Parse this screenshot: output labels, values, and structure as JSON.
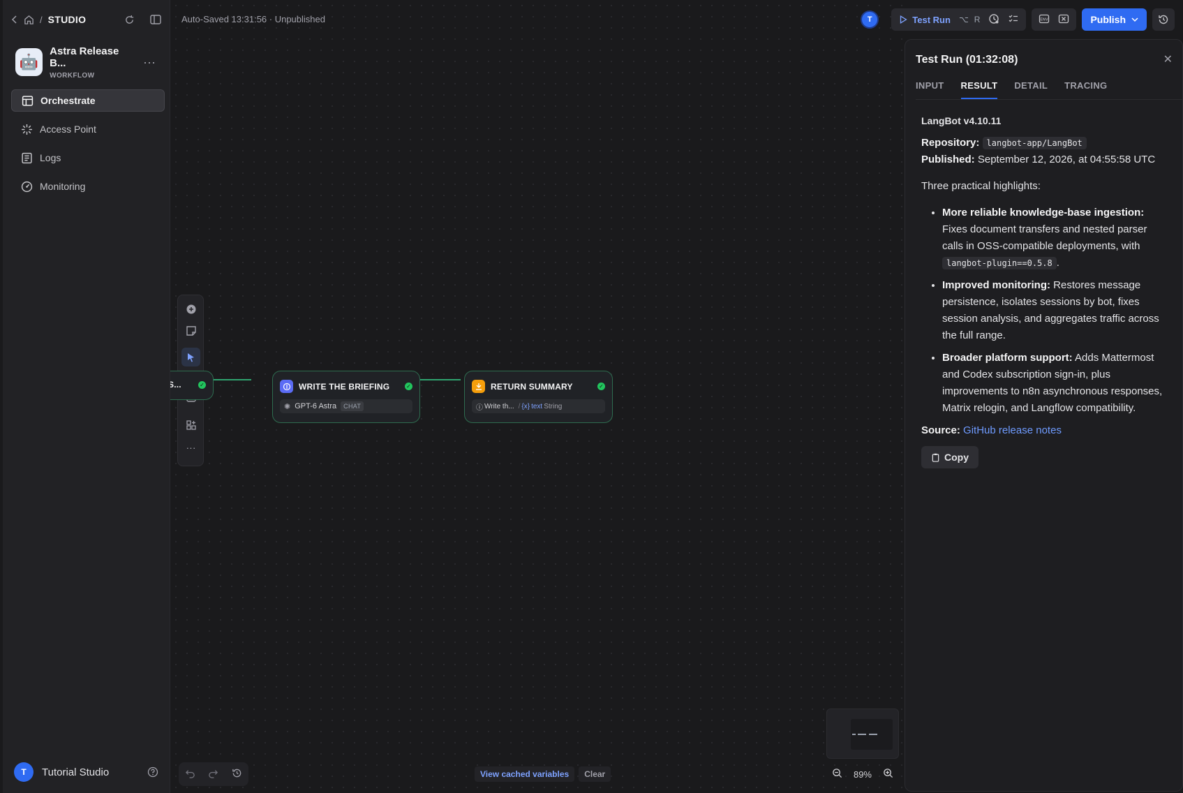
{
  "nav_top": {
    "studio": "STUDIO"
  },
  "app": {
    "name": "Astra Release B...",
    "type": "WORKFLOW",
    "avatar": "🤖"
  },
  "sidebar": {
    "items": [
      {
        "label": "Orchestrate",
        "icon": "orchestrate-icon",
        "active": true
      },
      {
        "label": "Access Point",
        "icon": "access-point-icon"
      },
      {
        "label": "Logs",
        "icon": "logs-icon"
      },
      {
        "label": "Monitoring",
        "icon": "monitoring-icon"
      }
    ]
  },
  "user": {
    "initial": "T",
    "name": "Tutorial Studio"
  },
  "canvas": {
    "autosave": "Auto-Saved 13:31:56 · Unpublished",
    "nodes": [
      {
        "title": "S...",
        "status": "success"
      },
      {
        "title": "WRITE THE BRIEFING",
        "model": "GPT-6 Astra",
        "badge": "CHAT",
        "status": "success",
        "color": "#5b6cf5"
      },
      {
        "title": "RETURN SUMMARY",
        "field": "Write th...",
        "var_prefix": "{x}",
        "var_name": "text",
        "var_type": "String",
        "status": "success",
        "color": "#f59e0b"
      }
    ],
    "zoom": "89%",
    "view_cached": "View cached variables",
    "clear": "Clear"
  },
  "header": {
    "avatar": "T",
    "test_run": "Test Run",
    "shortcut_mod": "⌥",
    "shortcut_key": "R",
    "publish": "Publish",
    "accent": "#2f6bf2"
  },
  "panel": {
    "title": "Test Run (01:32:08)",
    "tabs": [
      "INPUT",
      "RESULT",
      "DETAIL",
      "TRACING"
    ],
    "active_tab": "RESULT",
    "result": {
      "version": "LangBot v4.10.11",
      "repo_label": "Repository:",
      "repo_value": "langbot-app/LangBot",
      "published_label": "Published:",
      "published_value": "September 12, 2026, at 04:55:58 UTC",
      "intro": "Three practical highlights:",
      "highlights": [
        {
          "title": "More reliable knowledge-base ingestion:",
          "text": "Fixes document transfers and nested parser calls in OSS-compatible deployments, with",
          "code": "langbot-plugin==0.5.8",
          "suffix": "."
        },
        {
          "title": "Improved monitoring:",
          "text": "Restores message persistence, isolates sessions by bot, fixes session analysis, and aggregates traffic across the full range."
        },
        {
          "title": "Broader platform support:",
          "text": "Adds Mattermost and Codex subscription sign-in, plus improvements to n8n asynchronous responses, Matrix relogin, and Langflow compatibility."
        }
      ],
      "source_label": "Source:",
      "source_link": "GitHub release notes",
      "copy": "Copy"
    }
  }
}
